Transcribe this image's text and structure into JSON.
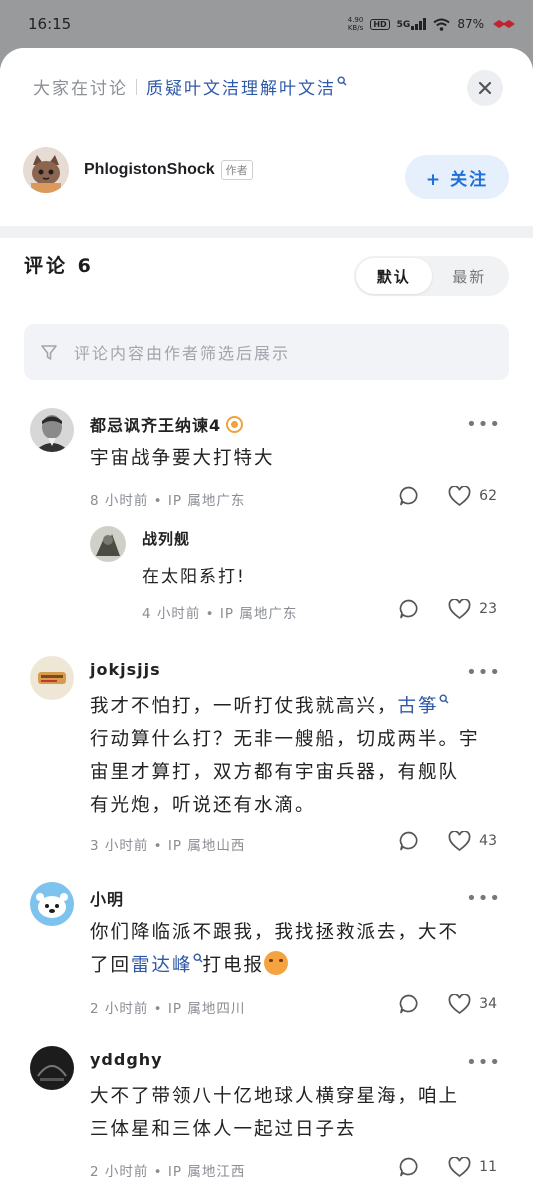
{
  "status_bar": {
    "time": "16:15",
    "speed_value": "4.90",
    "speed_unit": "KB/s",
    "hd": "HD",
    "network": "5G",
    "battery": "87%"
  },
  "sheet": {
    "discuss_label": "大家在讨论",
    "discuss_topic": "质疑叶文洁理解叶文洁",
    "close_icon": "close-icon",
    "author": {
      "name": "PhlogistonShock",
      "tag": "作者",
      "follow_label": "+ 关注"
    }
  },
  "comments_header": {
    "title": "评论 6",
    "sort_options": [
      "默认",
      "最新"
    ],
    "active_sort": "默认",
    "filter_text": "评论内容由作者筛选后展示"
  },
  "comments": [
    {
      "name": "都忌讽齐王纳谏4",
      "text": "宇宙战争要大打特大",
      "meta": "8 小时前 • IP 属地广东",
      "likes": "62",
      "reply": {
        "name": "战列舰",
        "text": "在太阳系打!",
        "meta": "4 小时前 • IP 属地广东",
        "likes": "23"
      }
    },
    {
      "name": "jokjsjjs",
      "text_before_link": "我才不怕打，一听打仗我就高兴，",
      "link": "古筝",
      "text_line2": "行动算什么打？无非一艘船，切成两半。宇",
      "text_line3": "宙里才算打，双方都有宇宙兵器，有舰队",
      "text_line4": "有光炮，听说还有水滴。",
      "meta": "3 小时前 • IP 属地山西",
      "likes": "43"
    },
    {
      "name": "小明",
      "text_line1": "你们降临派不跟我，我找拯救派去，大不",
      "text_before_link": "了回",
      "link": "雷达峰",
      "text_after_link": "打电报",
      "meta": "2 小时前 • IP 属地四川",
      "likes": "34"
    },
    {
      "name": "yddghy",
      "text_line1": "大不了带领八十亿地球人横穿星海，咱上",
      "text_line2": "三体星和三体人一起过日子去",
      "meta": "2 小时前 • IP 属地江西",
      "likes": "11"
    }
  ],
  "more_label": "•••"
}
